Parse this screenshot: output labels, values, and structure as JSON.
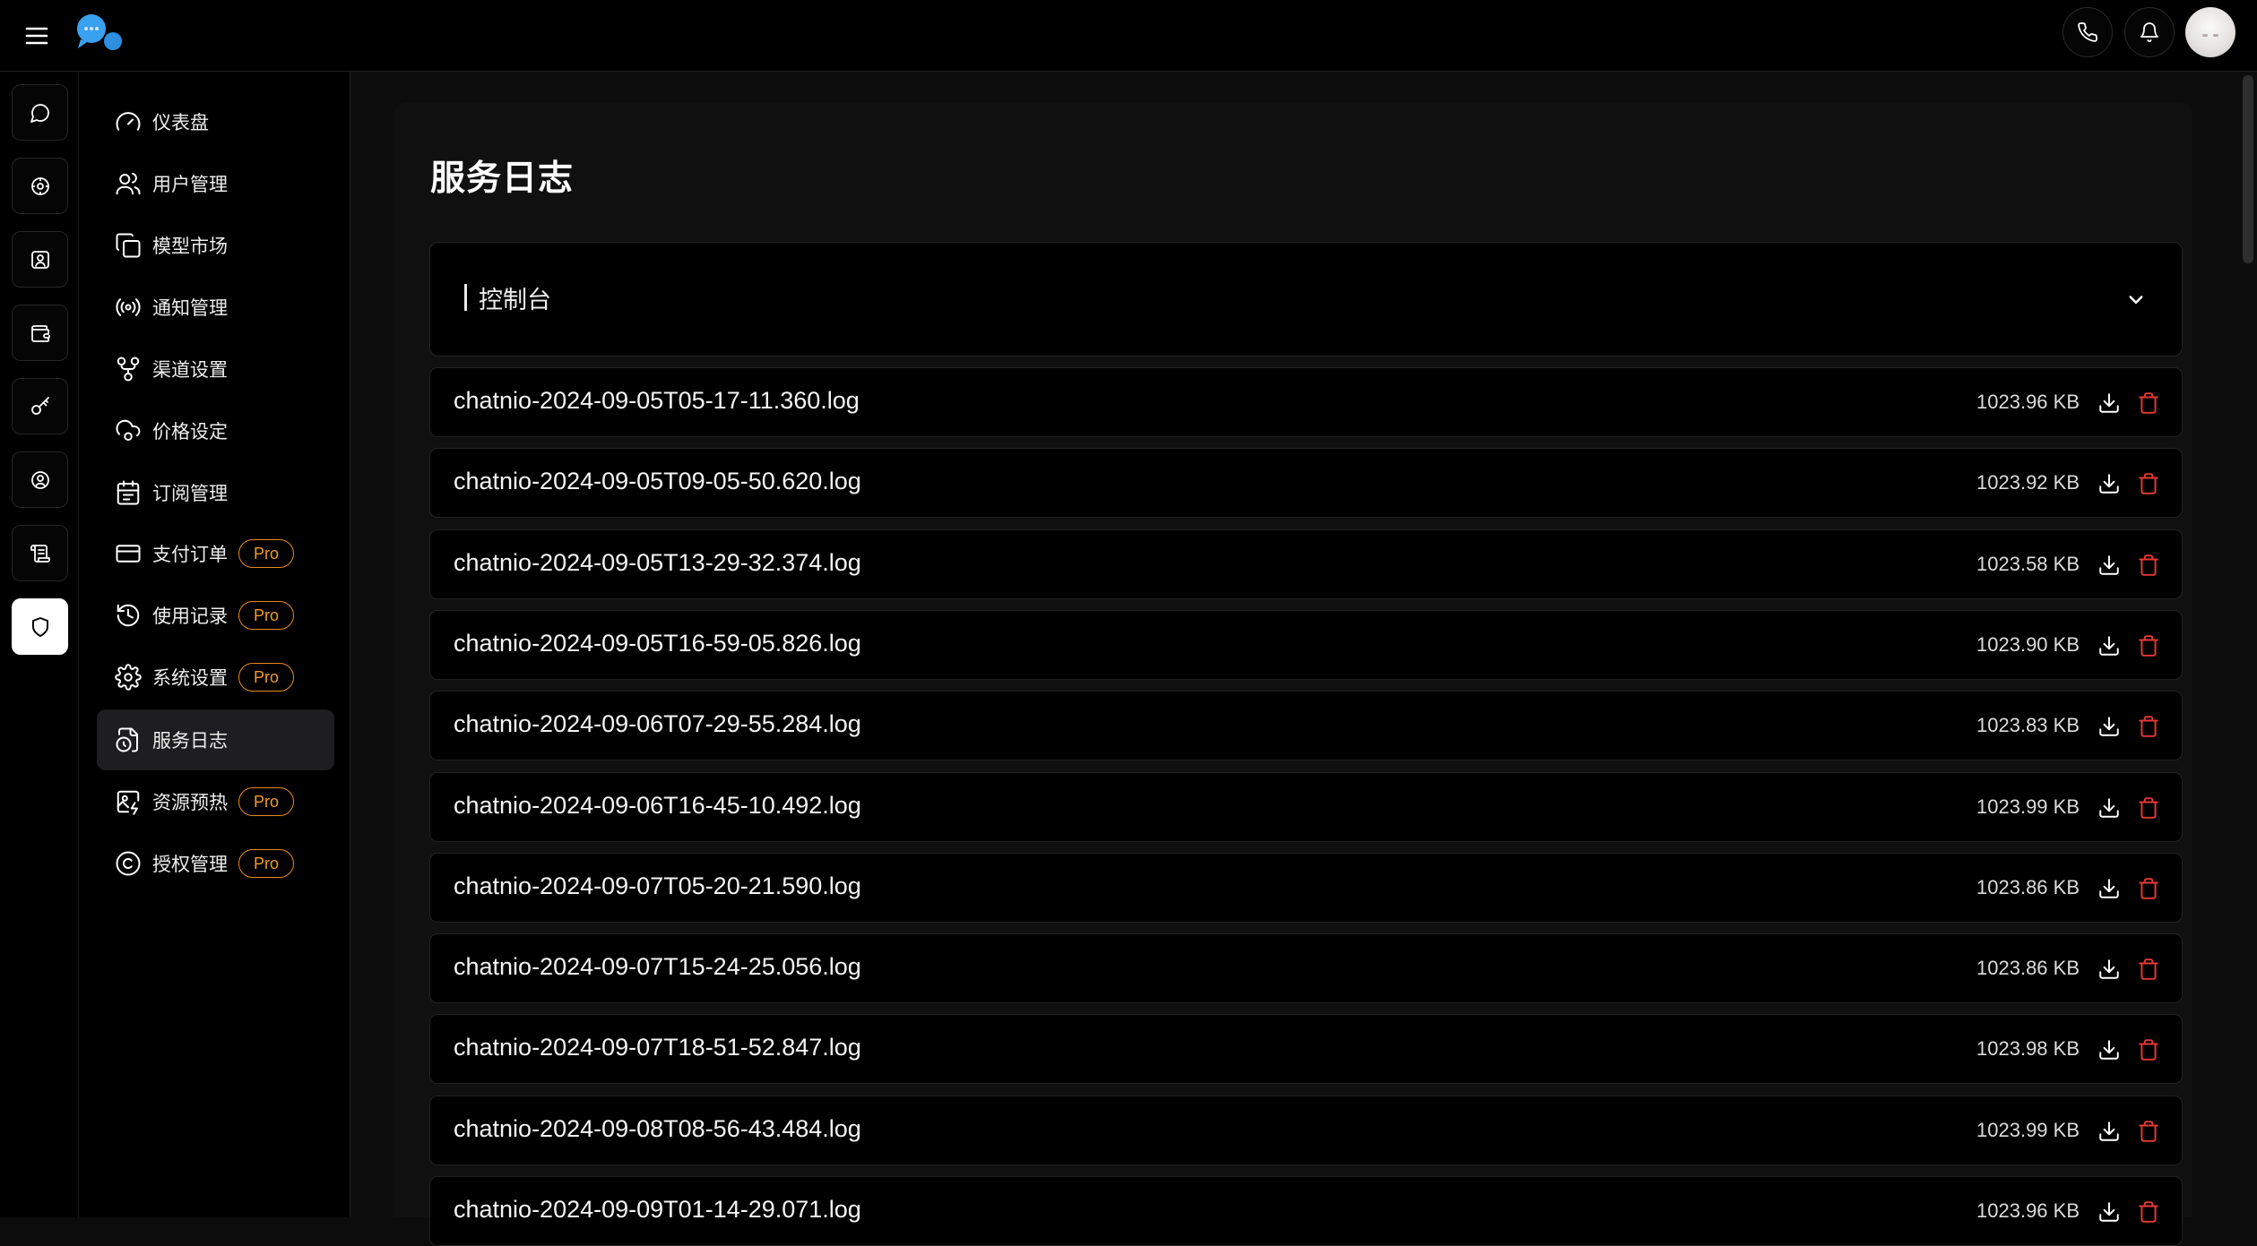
{
  "header": {
    "logo": "chat-bubbles-logo",
    "menu_icon": "hamburger-menu-icon",
    "actions": [
      "phone-icon",
      "bell-icon"
    ],
    "avatar": "user-avatar"
  },
  "rail": {
    "items": [
      {
        "icon": "chat-icon",
        "active": false
      },
      {
        "icon": "settings-circle-icon",
        "active": false
      },
      {
        "icon": "user-badge-icon",
        "active": false
      },
      {
        "icon": "wallet-icon",
        "active": false
      },
      {
        "icon": "key-icon",
        "active": false
      },
      {
        "icon": "account-circle-icon",
        "active": false
      },
      {
        "icon": "scroll-icon",
        "active": false
      },
      {
        "icon": "shield-icon",
        "active": true
      }
    ]
  },
  "sidebar": {
    "items": [
      {
        "label": "仪表盘",
        "icon": "gauge-icon",
        "pro": false,
        "active": false
      },
      {
        "label": "用户管理",
        "icon": "users-icon",
        "pro": false,
        "active": false
      },
      {
        "label": "模型市场",
        "icon": "copy-icon",
        "pro": false,
        "active": false
      },
      {
        "label": "通知管理",
        "icon": "broadcast-icon",
        "pro": false,
        "active": false
      },
      {
        "label": "渠道设置",
        "icon": "network-icon",
        "pro": false,
        "active": false
      },
      {
        "label": "价格设定",
        "icon": "cloud-cog-icon",
        "pro": false,
        "active": false
      },
      {
        "label": "订阅管理",
        "icon": "calendar-icon",
        "pro": false,
        "active": false
      },
      {
        "label": "支付订单",
        "icon": "credit-card-icon",
        "pro": true,
        "active": false
      },
      {
        "label": "使用记录",
        "icon": "history-icon",
        "pro": true,
        "active": false
      },
      {
        "label": "系统设置",
        "icon": "gear-icon",
        "pro": true,
        "active": false
      },
      {
        "label": "服务日志",
        "icon": "file-clock-icon",
        "pro": false,
        "active": true
      },
      {
        "label": "资源预热",
        "icon": "image-zap-icon",
        "pro": true,
        "active": false
      },
      {
        "label": "授权管理",
        "icon": "copyright-icon",
        "pro": true,
        "active": false
      }
    ],
    "pro_label": "Pro"
  },
  "main": {
    "title": "服务日志",
    "console_title": "控制台",
    "logs": [
      {
        "name": "chatnio-2024-09-05T05-17-11.360.log",
        "size": "1023.96 KB"
      },
      {
        "name": "chatnio-2024-09-05T09-05-50.620.log",
        "size": "1023.92 KB"
      },
      {
        "name": "chatnio-2024-09-05T13-29-32.374.log",
        "size": "1023.58 KB"
      },
      {
        "name": "chatnio-2024-09-05T16-59-05.826.log",
        "size": "1023.90 KB"
      },
      {
        "name": "chatnio-2024-09-06T07-29-55.284.log",
        "size": "1023.83 KB"
      },
      {
        "name": "chatnio-2024-09-06T16-45-10.492.log",
        "size": "1023.99 KB"
      },
      {
        "name": "chatnio-2024-09-07T05-20-21.590.log",
        "size": "1023.86 KB"
      },
      {
        "name": "chatnio-2024-09-07T15-24-25.056.log",
        "size": "1023.86 KB"
      },
      {
        "name": "chatnio-2024-09-07T18-51-52.847.log",
        "size": "1023.98 KB"
      },
      {
        "name": "chatnio-2024-09-08T08-56-43.484.log",
        "size": "1023.99 KB"
      },
      {
        "name": "chatnio-2024-09-09T01-14-29.071.log",
        "size": "1023.96 KB"
      }
    ]
  },
  "colors": {
    "background": "#000000",
    "accent_pro": "#e78a1f",
    "delete": "#e53935",
    "logo_blue": "#3aa0f0"
  }
}
